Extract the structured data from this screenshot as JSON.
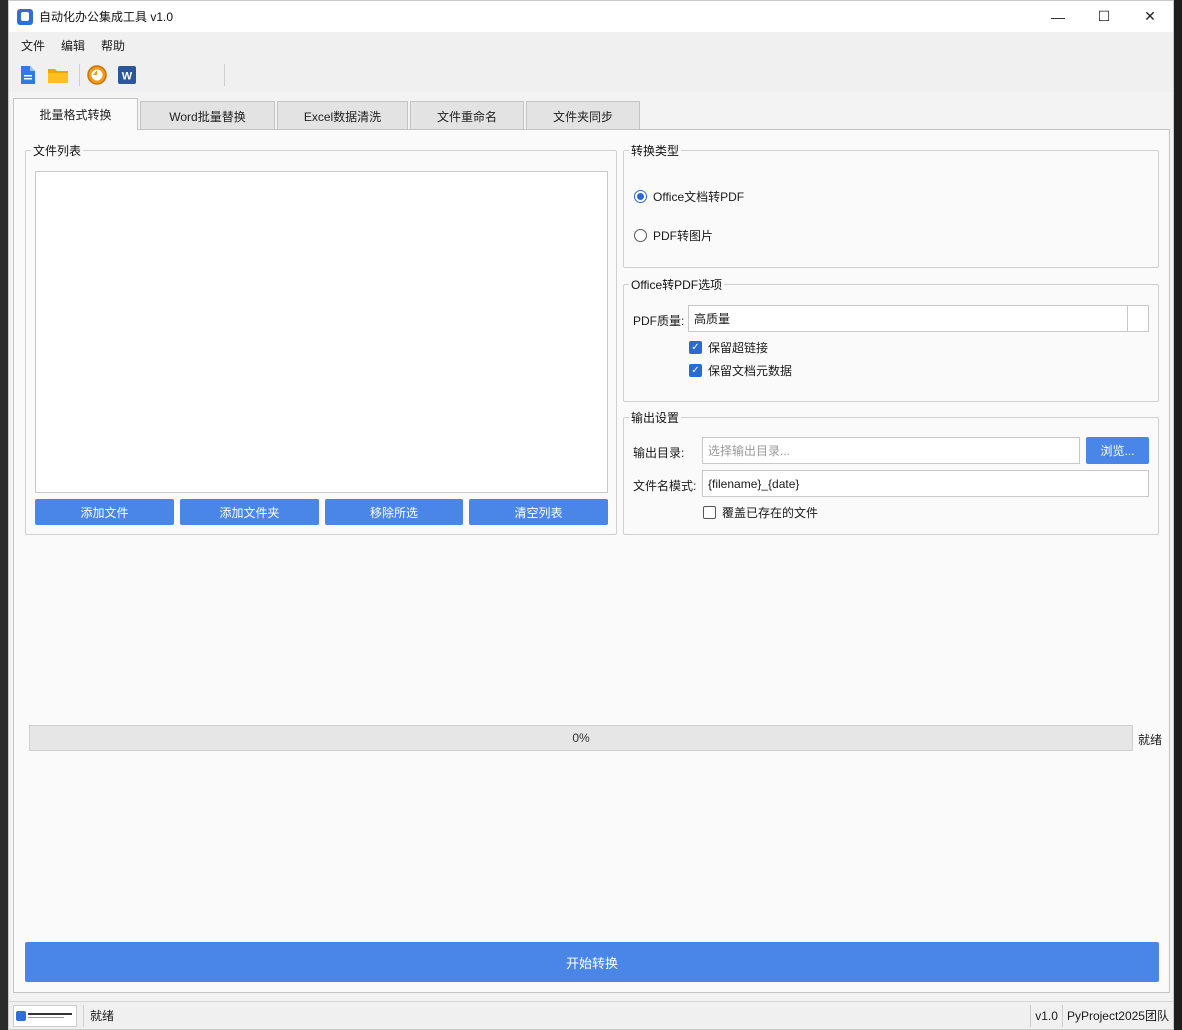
{
  "window": {
    "title": "自动化办公集成工具 v1.0",
    "controls": {
      "minimize": "—",
      "maximize": "☐",
      "close": "✕"
    }
  },
  "menu": [
    "文件",
    "编辑",
    "帮助"
  ],
  "toolbar": {
    "icons": [
      "new-file-icon",
      "open-folder-icon",
      "history-icon",
      "word-icon"
    ]
  },
  "tabs": [
    "批量格式转换",
    "Word批量替换",
    "Excel数据清洗",
    "文件重命名",
    "文件夹同步"
  ],
  "file_list": {
    "title": "文件列表",
    "buttons": [
      "添加文件",
      "添加文件夹",
      "移除所选",
      "清空列表"
    ]
  },
  "convert_type": {
    "title": "转换类型",
    "options": [
      {
        "label": "Office文档转PDF",
        "checked": true
      },
      {
        "label": "PDF转图片",
        "checked": false
      }
    ]
  },
  "pdf_options": {
    "title": "Office转PDF选项",
    "quality_label": "PDF质量:",
    "quality_value": "高质量",
    "checks": [
      {
        "label": "保留超链接",
        "checked": true
      },
      {
        "label": "保留文档元数据",
        "checked": true
      }
    ]
  },
  "output": {
    "title": "输出设置",
    "dir_label": "输出目录:",
    "dir_placeholder": "选择输出目录...",
    "browse": "浏览...",
    "pattern_label": "文件名模式:",
    "pattern_value": "{filename}_{date}",
    "overwrite_label": "覆盖已存在的文件",
    "overwrite_checked": false
  },
  "progress": {
    "value": 0,
    "text": "0%",
    "status": "就绪"
  },
  "start_button": "开始转换",
  "statusbar": {
    "message": "就绪",
    "version": "v1.0",
    "team": "PyProject2025团队"
  },
  "colors": {
    "accent": "#4a86e8",
    "radio": "#2a6bd1"
  }
}
